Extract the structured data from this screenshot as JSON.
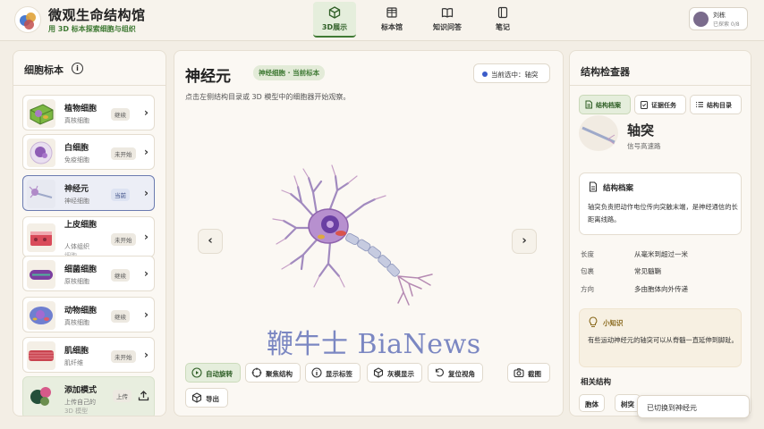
{
  "header": {
    "app_title": "微观生命结构馆",
    "app_subtitle": "用 3D 标本探索细胞与组织",
    "nav": [
      {
        "label": "3D展示",
        "active": true
      },
      {
        "label": "标本馆",
        "active": false
      },
      {
        "label": "知识问答",
        "active": false
      },
      {
        "label": "笔记",
        "active": false
      }
    ],
    "user": {
      "name": "刘栋",
      "progress": "已探索 0/8"
    }
  },
  "specimens": {
    "title": "细胞标本",
    "items": [
      {
        "name": "植物细胞",
        "sub": "真核细胞",
        "status": "继续"
      },
      {
        "name": "白细胞",
        "sub": "免疫细胞",
        "status": "未开始"
      },
      {
        "name": "神经元",
        "sub": "神经细胞",
        "status": "当前"
      },
      {
        "name": "上皮细胞",
        "sub": "人体组织",
        "sub2": "细胞",
        "status": "未开始"
      },
      {
        "name": "细菌细胞",
        "sub": "原核细胞",
        "status": "继续"
      },
      {
        "name": "动物细胞",
        "sub": "真核细胞",
        "status": "继续"
      },
      {
        "name": "肌细胞",
        "sub": "肌纤维",
        "status": "未开始"
      }
    ],
    "add_mode": {
      "name": "添加模式",
      "sub": "上传自己的",
      "sub2": "3D 模型",
      "action": "上传"
    }
  },
  "viewer": {
    "title": "神经元",
    "tag": "神经细胞 · 当前标本",
    "hint": "点击左侧结构目录或 3D 模型中的细胞器开始观察。",
    "selection": "当前选中：轴突",
    "prev_arrow": "‹",
    "next_arrow": "›",
    "tools": [
      "自动旋转",
      "聚焦结构",
      "显示标签",
      "灰模显示",
      "复位视角",
      "截图",
      "导出"
    ]
  },
  "inspector": {
    "title": "结构检查器",
    "tabs": [
      "结构档案",
      "证据任务",
      "结构目录"
    ],
    "structure_name": "轴突",
    "structure_sub": "信号高速路",
    "dossier_title": "结构档案",
    "dossier_body": "轴突负责把动作电位传向突触末端，是神经通信的长距离线路。",
    "props": [
      {
        "k": "长度",
        "v": "从毫米到超过一米"
      },
      {
        "k": "包裹",
        "v": "常见髓鞘"
      },
      {
        "k": "方向",
        "v": "多由胞体向外传递"
      }
    ],
    "tip_title": "小知识",
    "tip_body": "有些运动神经元的轴突可以从脊髓一直延伸到脚趾。",
    "related_title": "相关结构",
    "related": [
      "胞体",
      "树突"
    ]
  },
  "toast": "已切换到神经元",
  "watermark": "鞭牛士 BiaNews",
  "colors": {
    "accent_green": "#3f7a34",
    "current_blue": "#6b7bb0",
    "selection_dot": "#3b5cc9",
    "background": "#f3eee5"
  }
}
